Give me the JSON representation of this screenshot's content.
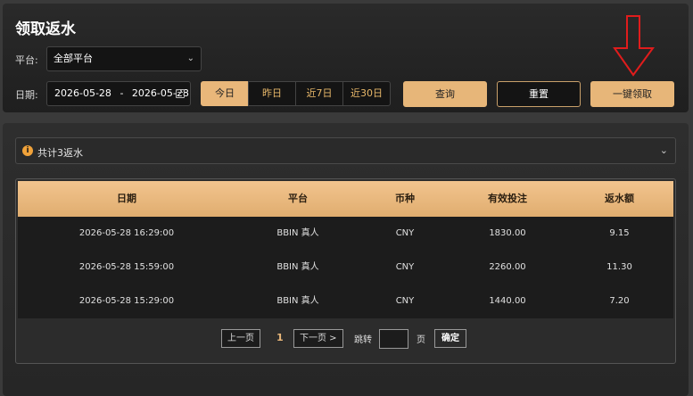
{
  "header": {
    "title": "领取返水",
    "platform_label": "平台:",
    "platform_value": "全部平台",
    "date_label": "日期:",
    "date_start": "2026-05-28",
    "date_sep": "-",
    "date_end": "2026-05-28",
    "ranges": [
      "今日",
      "昨日",
      "近7日",
      "近30日"
    ],
    "query_label": "查询",
    "reset_label": "重置",
    "claim_label": "一键领取",
    "accent_color": "#e7b679"
  },
  "summary": {
    "text": "共计3返水",
    "icon": "info-icon"
  },
  "table": {
    "columns": [
      "日期",
      "平台",
      "币种",
      "有效投注",
      "返水额"
    ],
    "rows": [
      [
        "2026-05-28 16:29:00",
        "BBIN 真人",
        "CNY",
        "1830.00",
        "9.15"
      ],
      [
        "2026-05-28 15:59:00",
        "BBIN 真人",
        "CNY",
        "2260.00",
        "11.30"
      ],
      [
        "2026-05-28 15:29:00",
        "BBIN 真人",
        "CNY",
        "1440.00",
        "7.20"
      ]
    ]
  },
  "pager": {
    "prev_label": "上一页",
    "current_page": "1",
    "next_label": "下一页 >",
    "jump_label": "跳转",
    "page_unit": "页",
    "confirm_label": "确定"
  }
}
